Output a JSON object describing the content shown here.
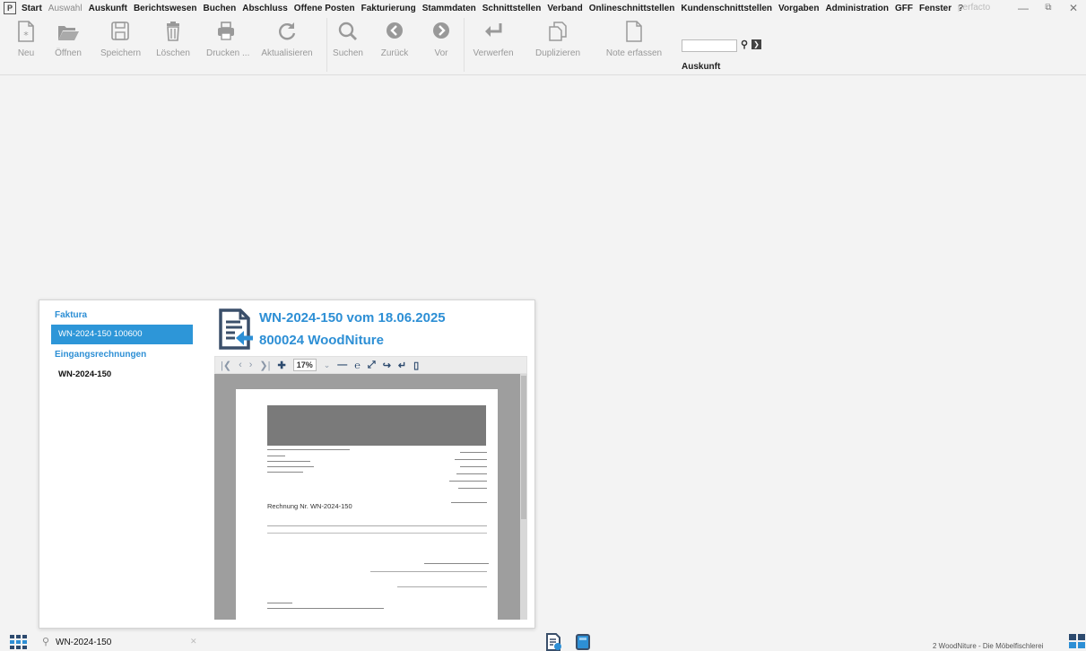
{
  "menubar": {
    "logo": "P",
    "items": [
      "Start",
      "Auswahl",
      "Auskunft",
      "Berichtswesen",
      "Buchen",
      "Abschluss",
      "Offene Posten",
      "Fakturierung",
      "Stammdaten",
      "Schnittstellen",
      "Verband",
      "Onlineschnittstellen",
      "Kundenschnittstellen",
      "Vorgaben",
      "Administration",
      "GFF",
      "Fenster",
      "?"
    ],
    "dim_item": "Auswahl",
    "brand": "perfacto"
  },
  "toolbar": {
    "buttons": [
      {
        "label": "Neu",
        "icon": "new-file-icon"
      },
      {
        "label": "Öffnen",
        "icon": "folder-open-icon"
      },
      {
        "label": "Speichern",
        "icon": "save-icon"
      },
      {
        "label": "Löschen",
        "icon": "trash-icon"
      },
      {
        "label": "Drucken ...",
        "icon": "printer-icon"
      },
      {
        "label": "Aktualisieren",
        "icon": "refresh-icon"
      },
      {
        "label": "Suchen",
        "icon": "search-icon"
      },
      {
        "label": "Zurück",
        "icon": "back-arrow-icon"
      },
      {
        "label": "Vor",
        "icon": "forward-arrow-icon"
      },
      {
        "label": "Verwerfen",
        "icon": "undo-icon"
      },
      {
        "label": "Duplizieren",
        "icon": "duplicate-icon"
      },
      {
        "label": "Note erfassen",
        "icon": "note-icon"
      }
    ],
    "search_value": "",
    "auskunft_label": "Auskunft"
  },
  "popup": {
    "sections": [
      {
        "heading": "Faktura",
        "items": [
          "WN-2024-150 100600"
        ]
      },
      {
        "heading": "Eingangsrechnungen",
        "items": [
          "WN-2024-150"
        ]
      }
    ],
    "title": "WN-2024-150 vom 18.06.2025",
    "subtitle": "800024 WoodNiture",
    "zoom": "17%",
    "paper": {
      "invoice_title": "Rechnung Nr. WN-2024-150"
    }
  },
  "bottombar": {
    "search_value": "WN-2024-150",
    "status": "2 WoodNiture - Die Möbelfischlerei"
  },
  "colors": {
    "accent": "#2d8fd5",
    "selected_bg": "#2d96d8",
    "app_bg": "#f3f3f3"
  }
}
